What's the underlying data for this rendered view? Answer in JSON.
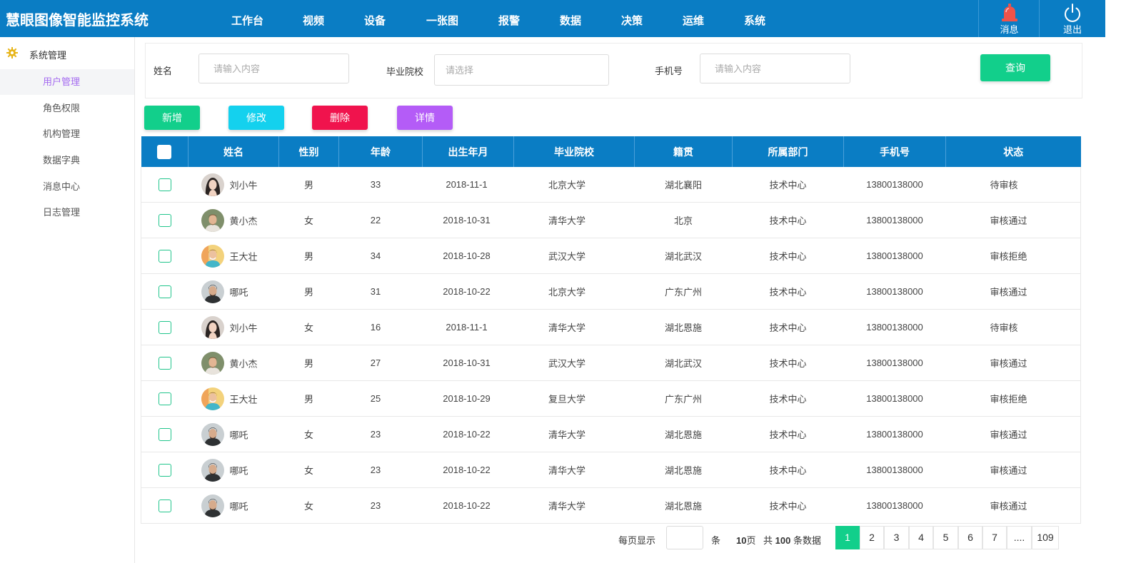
{
  "app": {
    "title": "慧眼图像智能监控系统"
  },
  "nav": [
    "工作台",
    "视频",
    "设备",
    "一张图",
    "报警",
    "数据",
    "决策",
    "运维",
    "系统"
  ],
  "top_actions": {
    "message": "消息",
    "logout": "退出"
  },
  "sidebar": {
    "group": "系统管理",
    "items": [
      {
        "label": "用户管理",
        "active": true
      },
      {
        "label": "角色权限"
      },
      {
        "label": "机构管理"
      },
      {
        "label": "数据字典"
      },
      {
        "label": "消息中心"
      },
      {
        "label": "日志管理"
      }
    ]
  },
  "filter": {
    "name_label": "姓名",
    "name_placeholder": "请输入内容",
    "school_label": "毕业院校",
    "school_placeholder": "请选择",
    "phone_label": "手机号",
    "phone_placeholder": "请输入内容",
    "query": "查询"
  },
  "actions": {
    "add": "新增",
    "edit": "修改",
    "delete": "删除",
    "detail": "详情"
  },
  "colors": {
    "header": "#0a7dc4",
    "green": "#12cf8b",
    "cyan": "#14d1ee",
    "red": "#f0134d",
    "purple": "#b45cf7"
  },
  "table": {
    "columns": [
      "姓名",
      "性别",
      "年龄",
      "出生年月",
      "毕业院校",
      "籍贯",
      "所属部门",
      "手机号",
      "状态"
    ],
    "rows": [
      {
        "name": "刘小牛",
        "avatar": "woman-avatar",
        "gender": "男",
        "age": "33",
        "birth": "2018-11-1",
        "school": "北京大学",
        "origin": "湖北襄阳",
        "dept": "技术中心",
        "phone": "13800138000",
        "status": "待审核"
      },
      {
        "name": "黄小杰",
        "avatar": "man-avatar",
        "gender": "女",
        "age": "22",
        "birth": "2018-10-31",
        "school": "清华大学",
        "origin": "北京",
        "dept": "技术中心",
        "phone": "13800138000",
        "status": "审核通过"
      },
      {
        "name": "王大壮",
        "avatar": "man-smile-avatar",
        "gender": "男",
        "age": "34",
        "birth": "2018-10-28",
        "school": "武汉大学",
        "origin": "湖北武汉",
        "dept": "技术中心",
        "phone": "13800138000",
        "status": "审核拒绝"
      },
      {
        "name": "哪吒",
        "avatar": "man-dark-avatar",
        "gender": "男",
        "age": "31",
        "birth": "2018-10-22",
        "school": "北京大学",
        "origin": "广东广州",
        "dept": "技术中心",
        "phone": "13800138000",
        "status": "审核通过"
      },
      {
        "name": "刘小牛",
        "avatar": "woman-avatar",
        "gender": "女",
        "age": "16",
        "birth": "2018-11-1",
        "school": "清华大学",
        "origin": "湖北恩施",
        "dept": "技术中心",
        "phone": "13800138000",
        "status": "待审核"
      },
      {
        "name": "黄小杰",
        "avatar": "man-avatar",
        "gender": "男",
        "age": "27",
        "birth": "2018-10-31",
        "school": "武汉大学",
        "origin": "湖北武汉",
        "dept": "技术中心",
        "phone": "13800138000",
        "status": "审核通过"
      },
      {
        "name": "王大壮",
        "avatar": "man-smile-avatar",
        "gender": "男",
        "age": "25",
        "birth": "2018-10-29",
        "school": "复旦大学",
        "origin": "广东广州",
        "dept": "技术中心",
        "phone": "13800138000",
        "status": "审核拒绝"
      },
      {
        "name": "哪吒",
        "avatar": "man-dark-avatar",
        "gender": "女",
        "age": "23",
        "birth": "2018-10-22",
        "school": "清华大学",
        "origin": "湖北恩施",
        "dept": "技术中心",
        "phone": "13800138000",
        "status": "审核通过"
      },
      {
        "name": "哪吒",
        "avatar": "man-dark-avatar",
        "gender": "女",
        "age": "23",
        "birth": "2018-10-22",
        "school": "清华大学",
        "origin": "湖北恩施",
        "dept": "技术中心",
        "phone": "13800138000",
        "status": "审核通过"
      },
      {
        "name": "哪吒",
        "avatar": "man-dark-avatar",
        "gender": "女",
        "age": "23",
        "birth": "2018-10-22",
        "school": "清华大学",
        "origin": "湖北恩施",
        "dept": "技术中心",
        "phone": "13800138000",
        "status": "审核通过"
      }
    ]
  },
  "pagination": {
    "per_page_label": "每页显示",
    "per_page_unit": "条",
    "total_pages_num": "10",
    "total_pages_unit": "页",
    "total_prefix": "共",
    "total_count": "100",
    "total_suffix": "条数据",
    "pages": [
      "1",
      "2",
      "3",
      "4",
      "5",
      "6",
      "7",
      "....",
      "109"
    ],
    "current": "1"
  }
}
